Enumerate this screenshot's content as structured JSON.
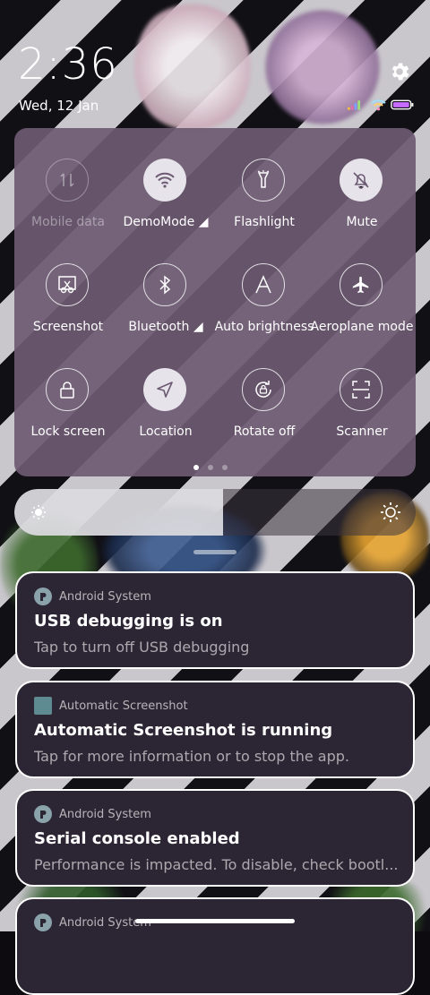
{
  "status": {
    "time": "2:36",
    "date": "Wed, 12 Jan",
    "icons": [
      "signal-icon",
      "wifi-icon",
      "battery-icon"
    ]
  },
  "settings_icon": "gear-icon",
  "quick_settings": {
    "tiles": [
      {
        "label": "Mobile data",
        "icon": "mobile-data-icon",
        "state": "disabled"
      },
      {
        "label": "DemoMode ◢",
        "icon": "wifi-icon",
        "state": "on"
      },
      {
        "label": "Flashlight",
        "icon": "flashlight-icon",
        "state": "off"
      },
      {
        "label": "Mute",
        "icon": "bell-off-icon",
        "state": "on"
      },
      {
        "label": "Screenshot",
        "icon": "screenshot-icon",
        "state": "off"
      },
      {
        "label": "Bluetooth ◢",
        "icon": "bluetooth-icon",
        "state": "off"
      },
      {
        "label": "Auto brightness",
        "icon": "auto-brightness-icon",
        "state": "off"
      },
      {
        "label": "Aeroplane mode",
        "icon": "airplane-icon",
        "state": "off"
      },
      {
        "label": "Lock screen",
        "icon": "lock-icon",
        "state": "off"
      },
      {
        "label": "Location",
        "icon": "location-icon",
        "state": "on"
      },
      {
        "label": "Rotate off",
        "icon": "rotate-icon",
        "state": "off"
      },
      {
        "label": "Scanner",
        "icon": "scanner-icon",
        "state": "off"
      }
    ],
    "page_count": 3,
    "active_page": 1
  },
  "brightness": {
    "level": 0.52
  },
  "notifications": [
    {
      "app": "Android System",
      "title": "USB debugging is on",
      "body": "Tap to turn off USB debugging"
    },
    {
      "app": "Automatic Screenshot",
      "title": "Automatic Screenshot is running",
      "body": "Tap for more information or to stop the app."
    },
    {
      "app": "Android System",
      "title": "Serial console enabled",
      "body": "Performance is impacted. To disable, check bootl..."
    },
    {
      "app": "Android System",
      "title": "",
      "body": ""
    }
  ],
  "colors": {
    "panel": "#6c5a72",
    "notification_bg": "#2c2533",
    "tile_on": "#e7e3ea"
  }
}
